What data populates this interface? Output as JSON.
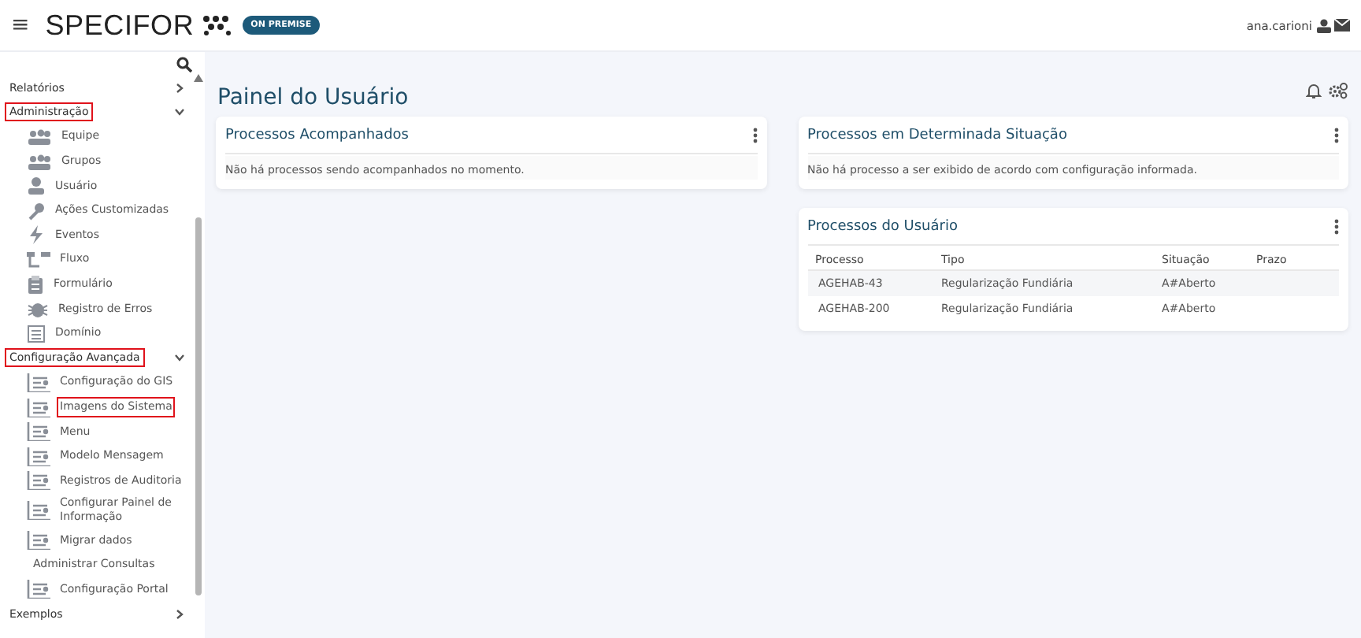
{
  "header": {
    "menu_glyph": "≡",
    "logo": "SPECIFOR",
    "badge": "ON PREMISE",
    "user": "ana.carioni"
  },
  "sidebar": {
    "items": [
      {
        "label": "Relatórios",
        "kind": "group",
        "expanded": false,
        "highlighted": false
      },
      {
        "label": "Administração",
        "kind": "group",
        "expanded": true,
        "highlighted": true,
        "children": [
          {
            "label": "Equipe",
            "kind": "team",
            "highlighted": false
          },
          {
            "label": "Grupos",
            "kind": "team",
            "highlighted": false
          },
          {
            "label": "Usuário",
            "kind": "user",
            "highlighted": false
          },
          {
            "label": "Ações Customizadas",
            "kind": "wrench",
            "highlighted": false
          },
          {
            "label": "Eventos",
            "kind": "bolt",
            "highlighted": false
          },
          {
            "label": "Fluxo",
            "kind": "flow",
            "highlighted": false
          },
          {
            "label": "Formulário",
            "kind": "clipboard",
            "highlighted": false
          },
          {
            "label": "Registro de Erros",
            "kind": "bug",
            "highlighted": false
          },
          {
            "label": "Domínio",
            "kind": "list",
            "highlighted": false
          }
        ]
      },
      {
        "label": "Configuração Avançada",
        "kind": "group",
        "expanded": true,
        "highlighted": true,
        "children": [
          {
            "label": "Configuração do GIS",
            "kind": "config",
            "highlighted": false
          },
          {
            "label": "Imagens do Sistema",
            "kind": "config",
            "highlighted": true
          },
          {
            "label": "Menu",
            "kind": "config",
            "highlighted": false
          },
          {
            "label": "Modelo Mensagem",
            "kind": "config",
            "highlighted": false
          },
          {
            "label": "Registros de Auditoria",
            "kind": "config",
            "highlighted": false
          },
          {
            "label": "Configurar Painel de Informação",
            "kind": "config",
            "highlighted": false
          },
          {
            "label": "Migrar dados",
            "kind": "config",
            "highlighted": false
          },
          {
            "label": "Administrar Consultas",
            "kind": "plain",
            "highlighted": false
          },
          {
            "label": "Configuração Portal",
            "kind": "config",
            "highlighted": false
          }
        ]
      },
      {
        "label": "Exemplos",
        "kind": "group",
        "expanded": false,
        "highlighted": false
      }
    ]
  },
  "page": {
    "title": "Painel do Usuário"
  },
  "left_column": {
    "cards": [
      {
        "title": "Processos Acompanhados",
        "message": "Não há processos sendo acompanhados no momento."
      }
    ]
  },
  "right_column": {
    "cards": [
      {
        "title": "Processos em Determinada Situação",
        "message": "Não há processo a ser exibido de acordo com configuração informada."
      },
      {
        "title": "Processos do Usuário",
        "table": {
          "columns": [
            "Processo",
            "Tipo",
            "Situação",
            "Prazo"
          ],
          "rows": [
            [
              "AGEHAB-43",
              "Regularização Fundiária",
              "A#Aberto"
            ],
            [
              "AGEHAB-200",
              "Regularização Fundiária",
              "A#Aberto"
            ]
          ]
        }
      }
    ]
  }
}
